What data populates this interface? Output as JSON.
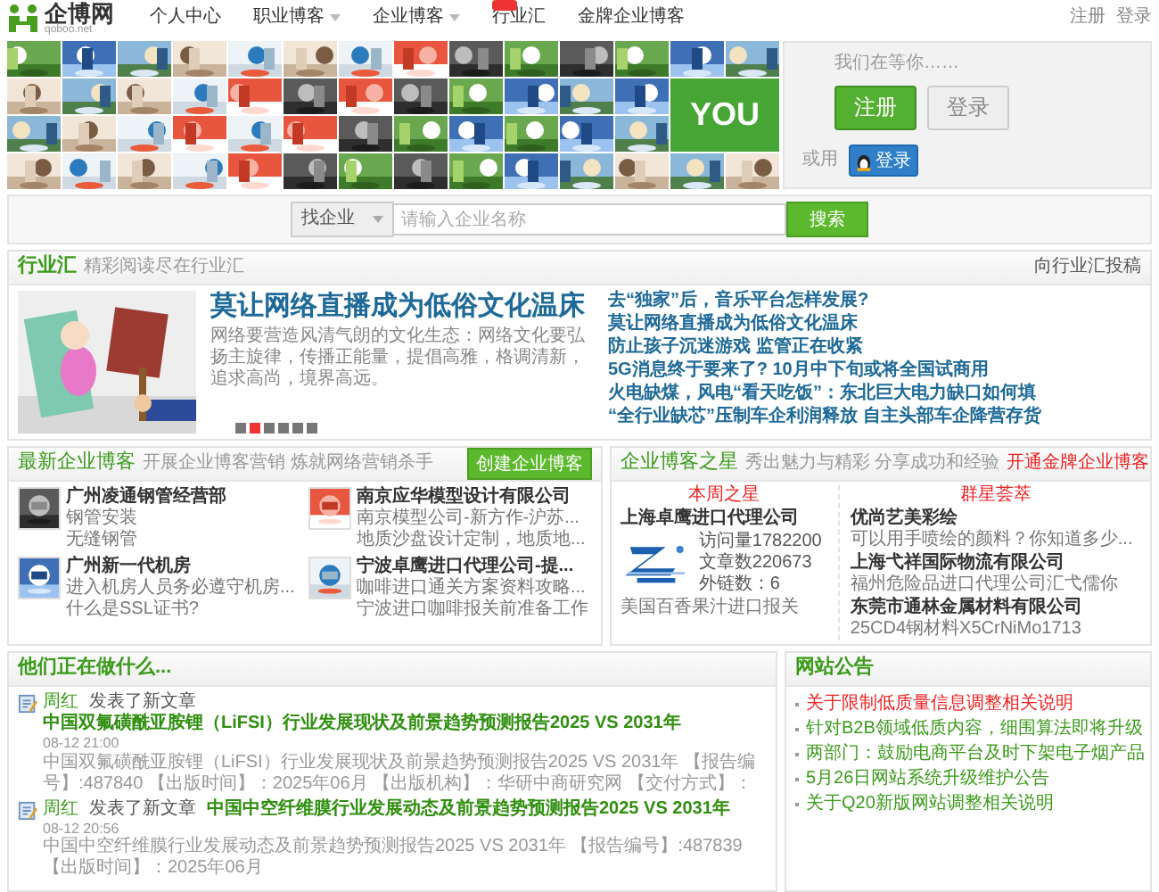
{
  "header": {
    "logo": "企博网",
    "logo_sub": "qoboo.net",
    "nav": [
      {
        "label": "个人中心",
        "dropdown": false,
        "badge": false
      },
      {
        "label": "职业博客",
        "dropdown": true,
        "badge": false
      },
      {
        "label": "企业博客",
        "dropdown": true,
        "badge": false
      },
      {
        "label": "行业汇",
        "dropdown": false,
        "badge": true
      },
      {
        "label": "金牌企业博客",
        "dropdown": false,
        "badge": false
      }
    ],
    "top_links": [
      "注册",
      "登录"
    ]
  },
  "hero": {
    "you": "YOU",
    "prompt": "我们在等你……",
    "register": "注册",
    "login": "登录",
    "or": "或用",
    "qq_login": "登录"
  },
  "search": {
    "scope": "找企业",
    "placeholder": "请输入企业名称",
    "button": "搜索"
  },
  "industry": {
    "title": "行业汇",
    "subtitle": "精彩阅读尽在行业汇",
    "link": "向行业汇投稿",
    "headline": "莫让网络直播成为低俗文化温床",
    "summary": "网络要营造风清气朗的文化生态：网络文化要弘扬主旋律，传播正能量，提倡高雅，格调清新，追求高尚，境界高远。",
    "links": [
      "去“独家”后，音乐平台怎样发展?",
      "莫让网络直播成为低俗文化温床",
      "防止孩子沉迷游戏 监管正在收紧",
      "5G消息终于要来了? 10月中下旬或将全国试商用",
      "火电缺煤，风电“看天吃饭”：东北巨大电力缺口如何填",
      "“全行业缺芯”压制车企利润释放 自主头部车企降营存货"
    ],
    "dots": [
      {
        "selected": false
      },
      {
        "selected": true
      },
      {
        "selected": false
      },
      {
        "selected": false
      },
      {
        "selected": false
      },
      {
        "selected": false
      }
    ]
  },
  "new_blogs": {
    "title": "最新企业博客",
    "subtitle": "开展企业博客营销 炼就网络营销杀手",
    "button": "创建企业博客",
    "items": [
      {
        "name": "广州凌通钢管经营部",
        "lines": [
          "钢管安装",
          "无缝钢管"
        ]
      },
      {
        "name": "南京应华模型设计有限公司",
        "lines": [
          "南京模型公司-新方作-沪苏...",
          "地质沙盘设计定制，地质地..."
        ]
      },
      {
        "name": "广州新一代机房",
        "lines": [
          "进入机房人员务必遵守机房...",
          "什么是SSL证书?"
        ]
      },
      {
        "name": "宁波卓鹰进口代理公司-提...",
        "lines": [
          "咖啡进口通关方案资料攻略...",
          "宁波进口咖啡报关前准备工作"
        ]
      }
    ]
  },
  "stars": {
    "title": "企业博客之星",
    "subtitle": "秀出魅力与精彩 分享成功和经验",
    "link": "开通金牌企业博客",
    "week": {
      "label": "本周之星",
      "company": "上海卓鹰进口代理公司",
      "stats": [
        "访问量1782200",
        "文章数220673",
        "外链数：6"
      ],
      "article": "美国百香果汁进口报关"
    },
    "group": {
      "label": "群星荟萃",
      "items": [
        {
          "name": "优尚艺美彩绘",
          "desc": "可以用手喷绘的颜料？你知道多少..."
        },
        {
          "name": "上海弋祥国际物流有限公司",
          "desc": "福州危险品进口代理公司汇弋儒你"
        },
        {
          "name": "东莞市通林金属材料有限公司",
          "desc": "25CD4钢材料X5CrNiMo1713"
        }
      ]
    }
  },
  "activity": {
    "title": "他们正在做什么...",
    "items": [
      {
        "user": "周红",
        "action": "发表了新文章",
        "title": "中国双氟磺酰亚胺锂（LiFSI）行业发展现状及前景趋势预测报告2025 VS 2031年",
        "time": "08-12 21:00",
        "summary": "中国双氟磺酰亚胺锂（LiFSI）行业发展现状及前景趋势预测报告2025 VS 2031年 【报告编号】:487840 【出版时间】：2025年06月 【出版机构】：华研中商研究网 【交付方式】："
      },
      {
        "user": "周红",
        "action": "发表了新文章",
        "title": "中国中空纤维膜行业发展动态及前景趋势预测报告2025 VS 2031年",
        "time": "08-12 20:56",
        "summary": "中国中空纤维膜行业发展动态及前景趋势预测报告2025 VS 2031年 【报告编号】:487839 【出版时间】：2025年06月"
      }
    ]
  },
  "notices": {
    "title": "网站公告",
    "items": [
      {
        "text": "关于限制低质量信息调整相关说明",
        "highlight": true
      },
      {
        "text": "针对B2B领域低质内容，细围算法即将升级",
        "highlight": false
      },
      {
        "text": "两部门：鼓励电商平台及时下架电子烟产品",
        "highlight": false
      },
      {
        "text": "5月26日网站系统升级维护公告",
        "highlight": false
      },
      {
        "text": "关于Q20新版网站调整相关说明",
        "highlight": false
      }
    ]
  }
}
